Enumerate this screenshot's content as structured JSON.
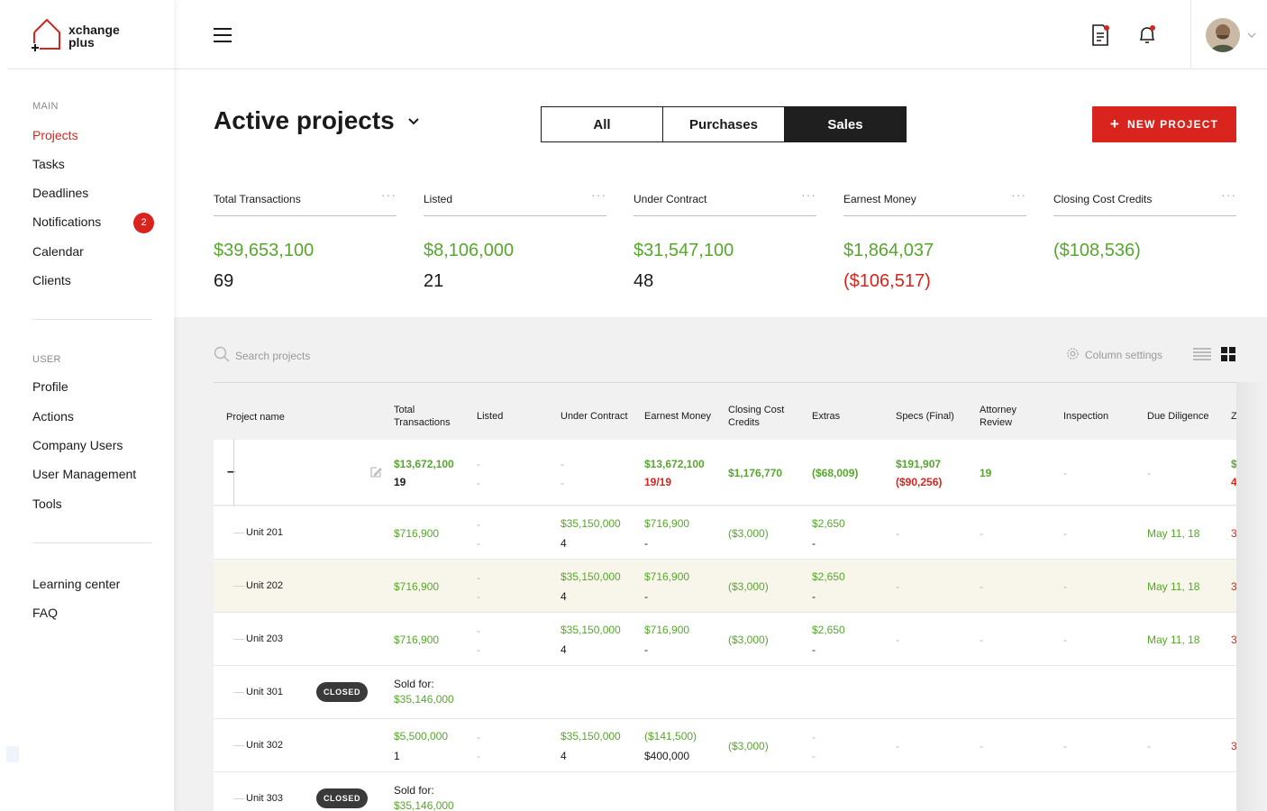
{
  "brand": {
    "line1": "xchange",
    "line2": "plus",
    "accent": "#d8241c"
  },
  "sidebar": {
    "main_label": "MAIN",
    "main_items": [
      {
        "label": "Projects",
        "active": true
      },
      {
        "label": "Tasks"
      },
      {
        "label": "Deadlines"
      },
      {
        "label": "Notifications",
        "badge": "2"
      },
      {
        "label": "Calendar"
      },
      {
        "label": "Clients"
      }
    ],
    "user_label": "USER",
    "user_items": [
      {
        "label": "Profile"
      },
      {
        "label": "Actions"
      },
      {
        "label": "Company Users"
      },
      {
        "label": "User Management"
      },
      {
        "label": "Tools"
      }
    ],
    "footer_items": [
      {
        "label": "Learning center"
      },
      {
        "label": "FAQ"
      }
    ]
  },
  "topbar": {
    "icons": [
      "hamburger-menu-icon",
      "document-icon",
      "bell-icon",
      "avatar",
      "chevron-down-icon"
    ]
  },
  "page": {
    "title": "Active projects",
    "filters": [
      {
        "label": "All",
        "selected": false
      },
      {
        "label": "Purchases",
        "selected": false
      },
      {
        "label": "Sales",
        "selected": true
      }
    ],
    "new_project_label": "NEW PROJECT"
  },
  "stats": [
    {
      "label": "Total Transactions",
      "value": "$39,653,100",
      "sub": "69",
      "sub_color": "default"
    },
    {
      "label": "Listed",
      "value": "$8,106,000",
      "sub": "21",
      "sub_color": "default"
    },
    {
      "label": "Under Contract",
      "value": "$31,547,100",
      "sub": "48",
      "sub_color": "default"
    },
    {
      "label": "Earnest Money",
      "value": "$1,864,037",
      "sub": "($106,517)",
      "sub_color": "red"
    },
    {
      "label": "Closing Cost Credits",
      "value": "($108,536)",
      "sub": "",
      "sub_color": "default"
    }
  ],
  "table": {
    "search_placeholder": "Search projects",
    "column_settings_label": "Column settings",
    "columns": [
      "Project name",
      "Total Transactions",
      "Listed",
      "Under Contract",
      "Earnest Money",
      "Closing Cost Credits",
      "Extras",
      "Specs (Final)",
      "Attorney Review",
      "Inspection",
      "Due Diligence",
      "Z"
    ],
    "group_row": {
      "expand_symbol": "–",
      "total": "$13,672,100",
      "total_count": "19",
      "listed": "-",
      "listed2": "-",
      "under_contract": "-",
      "under_contract2": "-",
      "earnest": "$13,672,100",
      "earnest_count": "19/19",
      "closing": "$1,176,770",
      "extras": "($68,009)",
      "specs": "$191,907",
      "specs2": "($90,256)",
      "attorney": "19",
      "inspection": "-",
      "due": "-",
      "z1": "$",
      "z2": "4"
    },
    "units": [
      {
        "name": "Unit 201",
        "total": "$716,900",
        "listed": "-",
        "listed2": "-",
        "uc": "$35,150,000",
        "uc2": "4",
        "earnest": "$716,900",
        "earnest2": "-",
        "closing": "($3,000)",
        "extras": "$2,650",
        "extras2": "-",
        "specs": "-",
        "attorney": "-",
        "inspection": "-",
        "due": "May 11, 18",
        "z": "3"
      },
      {
        "name": "Unit 202",
        "total": "$716,900",
        "listed": "-",
        "listed2": "-",
        "uc": "$35,150,000",
        "uc2": "4",
        "earnest": "$716,900",
        "earnest2": "-",
        "closing": "($3,000)",
        "extras": "$2,650",
        "extras2": "-",
        "specs": "-",
        "attorney": "-",
        "inspection": "-",
        "due": "May 11, 18",
        "z": "3"
      },
      {
        "name": "Unit 203",
        "total": "$716,900",
        "listed": "-",
        "listed2": "-",
        "uc": "$35,150,000",
        "uc2": "4",
        "earnest": "$716,900",
        "earnest2": "-",
        "closing": "($3,000)",
        "extras": "$2,650",
        "extras2": "-",
        "specs": "-",
        "attorney": "-",
        "inspection": "-",
        "due": "May 11, 18",
        "z": "3"
      }
    ],
    "closed_301": {
      "name": "Unit 301",
      "badge": "CLOSED",
      "sold_label": "Sold for:",
      "sold_value": "$35,146,000"
    },
    "unit_302": {
      "name": "Unit 302",
      "total": "$5,500,000",
      "total2": "1",
      "listed": "-",
      "listed2": "-",
      "uc": "$35,150,000",
      "uc2": "4",
      "earnest": "($141,500)",
      "earnest2": "$400,000",
      "closing": "($3,000)",
      "extras": "-",
      "extras2": "-",
      "specs": "-",
      "attorney": "-",
      "inspection": "-",
      "due": "-",
      "z": "3"
    },
    "closed_303": {
      "name": "Unit 303",
      "badge": "CLOSED",
      "sold_label": "Sold for:",
      "sold_value": "$35,146,000"
    }
  }
}
